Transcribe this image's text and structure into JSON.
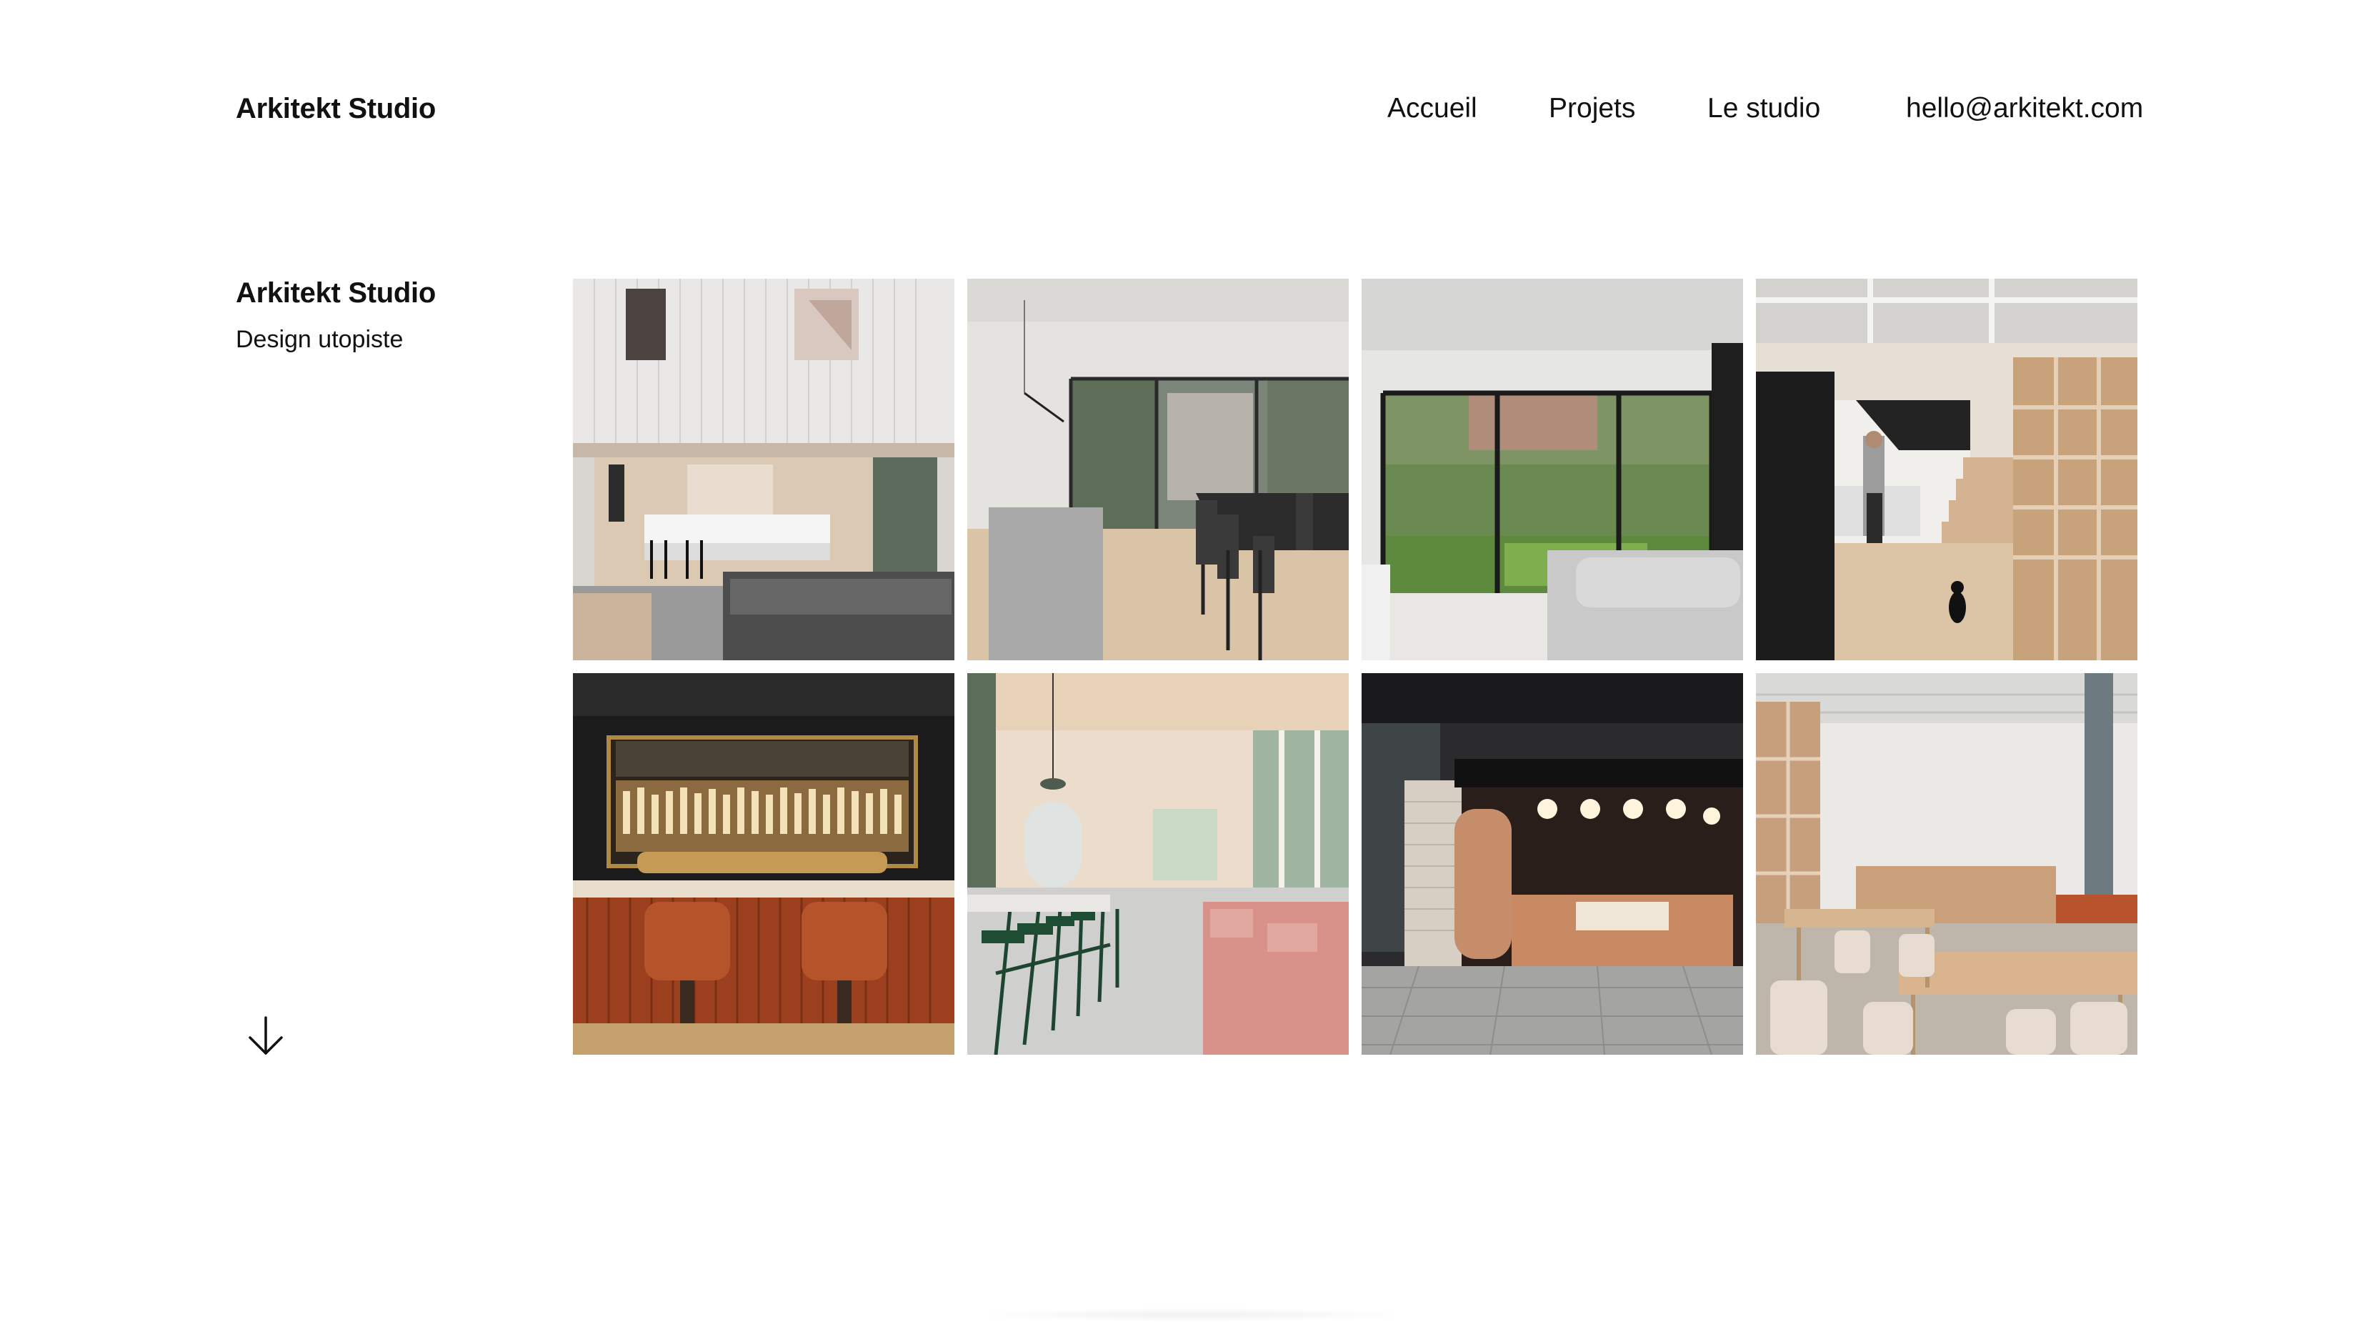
{
  "header": {
    "brand": "Arkitekt Studio",
    "nav": {
      "home": "Accueil",
      "projects": "Projets",
      "studio": "Le studio",
      "email": "hello@arkitekt.com"
    }
  },
  "intro": {
    "title": "Arkitekt Studio",
    "tagline": "Design utopiste",
    "scroll_icon": "arrow-down-icon"
  },
  "gallery": {
    "items": [
      {
        "subject": "double-height kitchen and living room"
      },
      {
        "subject": "minimal dining room with garden view"
      },
      {
        "subject": "living room with sliding glass doors to garden"
      },
      {
        "subject": "basement with wooden stairs and shelving"
      },
      {
        "subject": "bar with backlit bottle shelf and leather stools"
      },
      {
        "subject": "pink cafe with green bar stools"
      },
      {
        "subject": "coffee kiosk with pendant lights"
      },
      {
        "subject": "open cafe with wooden tables and shelves"
      }
    ]
  },
  "colors": {
    "text": "#111111",
    "background": "#ffffff"
  }
}
